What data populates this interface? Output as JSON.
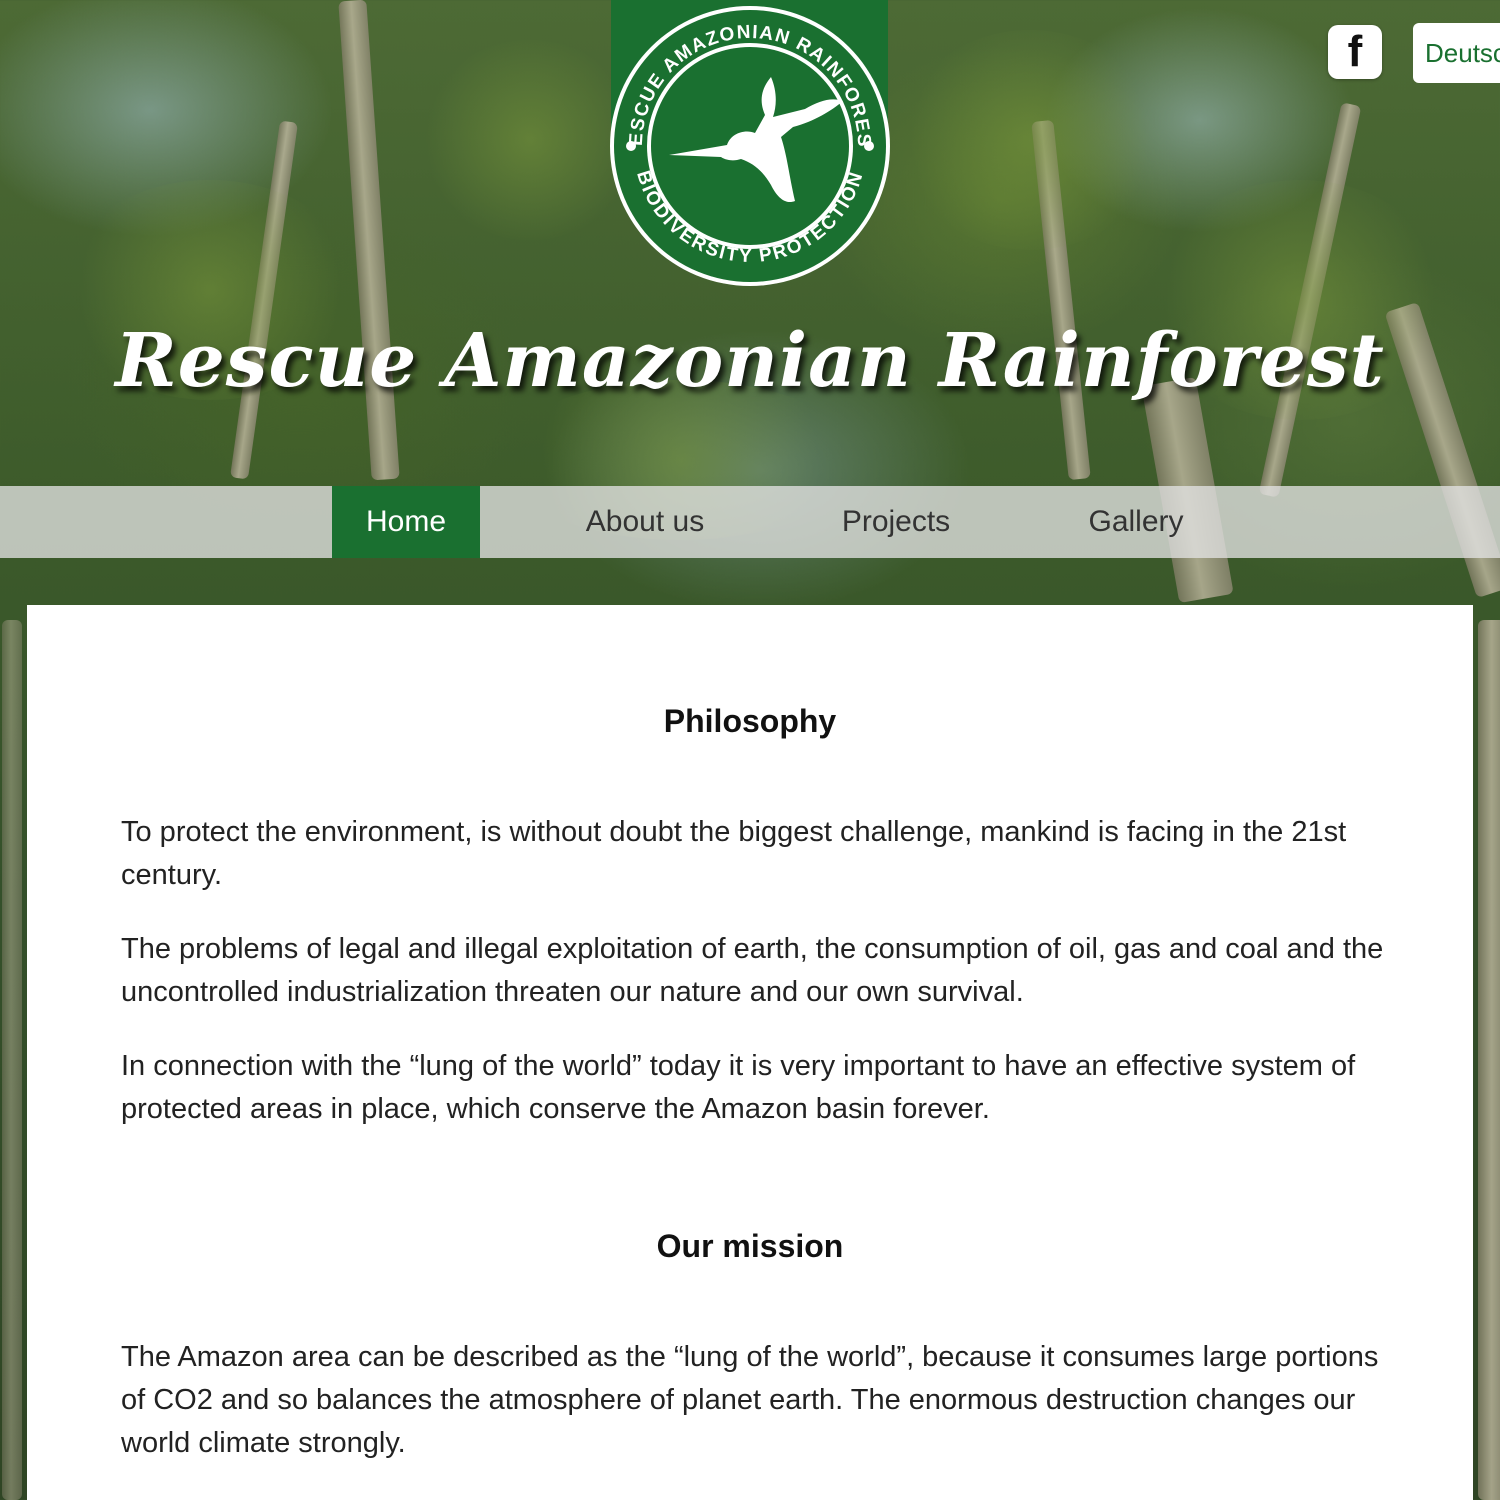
{
  "site": {
    "title": "Rescue Amazonian Rainforest",
    "logo": {
      "text_top": "RESCUE AMAZONIAN RAINFOREST",
      "text_bottom": "BIODIVERSITY PROTECTION",
      "icon": "hummingbird-icon",
      "color": "#1a7030"
    }
  },
  "header": {
    "social": {
      "icon": "facebook-icon",
      "glyph": "f"
    },
    "language": {
      "label": "Deutsch"
    }
  },
  "nav": {
    "items": [
      {
        "label": "Home",
        "active": true
      },
      {
        "label": "About us",
        "active": false
      },
      {
        "label": "Projects",
        "active": false
      },
      {
        "label": "Gallery",
        "active": false
      }
    ]
  },
  "sections": [
    {
      "title": "Philosophy",
      "paragraphs": [
        "To protect the environment, is without doubt the biggest challenge, mankind is facing in the 21st century.",
        "The problems of legal and illegal exploitation of earth, the consumption of oil, gas and coal and the uncontrolled industrialization threaten our nature and our own survival.",
        "In connection with the “lung of the world” today it is very important to have an effective system of protected areas in place, which conserve the Amazon basin forever."
      ]
    },
    {
      "title": "Our mission",
      "paragraphs": [
        "The Amazon area can be described as the “lung of the world”, because it consumes large portions of CO2 and so balances the atmosphere of planet earth. The enormous destruction changes our world climate strongly."
      ]
    }
  ],
  "colors": {
    "accent": "#1a7030",
    "nav_background": "#e1e1e1",
    "card_background": "#ffffff"
  }
}
